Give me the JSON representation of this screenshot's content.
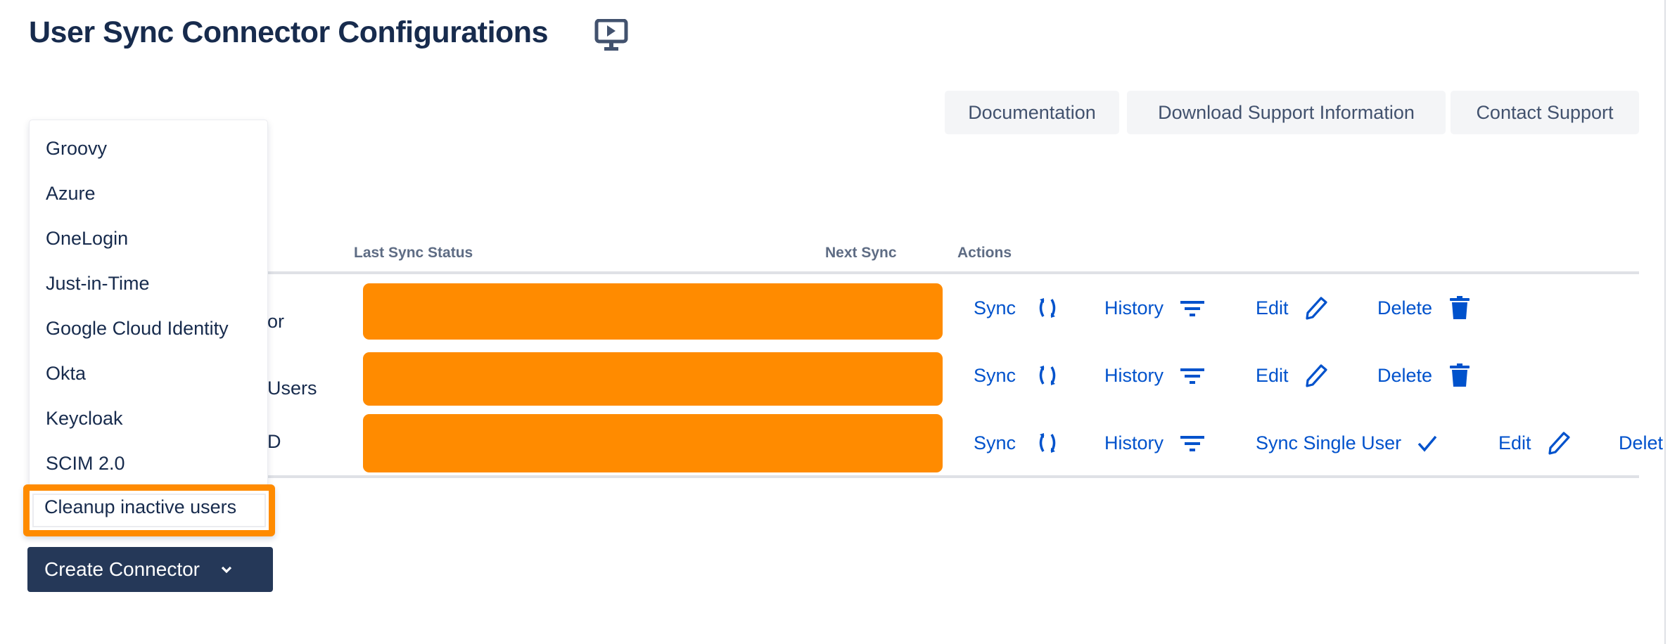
{
  "page": {
    "title": "User Sync Connector Configurations",
    "title_icon": "monitor-play-icon"
  },
  "toolbar": {
    "documentation": "Documentation",
    "download_support": "Download Support Information",
    "contact_support": "Contact Support"
  },
  "table": {
    "headers": {
      "last_sync_status": "Last Sync Status",
      "next_sync": "Next Sync",
      "actions": "Actions"
    },
    "rows": [
      {
        "name_visible": "or",
        "actions": {
          "sync": "Sync",
          "history": "History",
          "edit": "Edit",
          "delete": "Delete"
        }
      },
      {
        "name_visible": "Users",
        "actions": {
          "sync": "Sync",
          "history": "History",
          "edit": "Edit",
          "delete": "Delete"
        }
      },
      {
        "name_visible": "D",
        "actions": {
          "sync": "Sync",
          "history": "History",
          "sync_single_user": "Sync Single User",
          "edit": "Edit",
          "delete": "Delet"
        }
      }
    ],
    "status_color": "#ff8b00"
  },
  "dropdown": {
    "items": [
      "Groovy",
      "Azure",
      "OneLogin",
      "Just-in-Time",
      "Google Cloud Identity",
      "Okta",
      "Keycloak",
      "SCIM 2.0",
      "Cleanup inactive users"
    ],
    "highlighted_index": 8,
    "highlight_color": "#ff8b00"
  },
  "create_button": {
    "label": "Create Connector",
    "icon": "chevron-down-icon",
    "color": "#253858"
  },
  "colors": {
    "link": "#0052cc",
    "text": "#172b4d"
  }
}
